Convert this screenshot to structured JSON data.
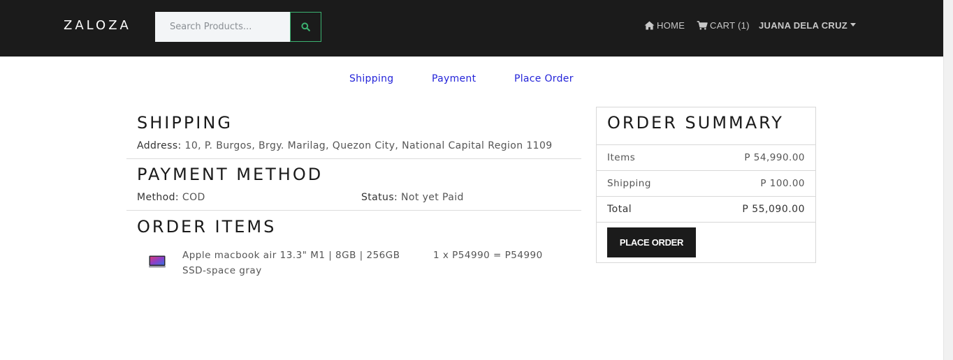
{
  "navbar": {
    "brand": "ZALOZA",
    "search_placeholder": "Search Products...",
    "home_label": "HOME",
    "cart_label": "CART (1)",
    "user_label": "JUANA DELA CRUZ",
    "icons": {
      "search": "search-icon",
      "home": "home-icon",
      "cart": "cart-icon",
      "user_menu": "caret-down-icon"
    },
    "colors": {
      "background": "#1b1b1b",
      "search_button_border": "#3cb371"
    }
  },
  "steps": {
    "shipping": "Shipping",
    "payment": "Payment",
    "place_order": "Place Order",
    "color": "#2424d9"
  },
  "shipping": {
    "title": "SHIPPING",
    "address_label": "Address:",
    "address_value": "10, P. Burgos, Brgy. Marilag, Quezon City, National Capital Region 1109"
  },
  "payment": {
    "title": "PAYMENT METHOD",
    "method_label": "Method:",
    "method_value": "COD",
    "status_label": "Status:",
    "status_value": "Not yet Paid"
  },
  "order_items": {
    "title": "ORDER ITEMS",
    "items": [
      {
        "name": "Apple macbook air 13.3\" M1 | 8GB | 256GB SSD-space gray",
        "calc": "1 x P54990 = P54990",
        "image": "laptop-thumbnail"
      }
    ]
  },
  "summary": {
    "title": "ORDER SUMMARY",
    "items_label": "Items",
    "items_value": "P 54,990.00",
    "shipping_label": "Shipping",
    "shipping_value": "P 100.00",
    "total_label": "Total",
    "total_value": "P 55,090.00",
    "button_label": "PLACE ORDER"
  }
}
